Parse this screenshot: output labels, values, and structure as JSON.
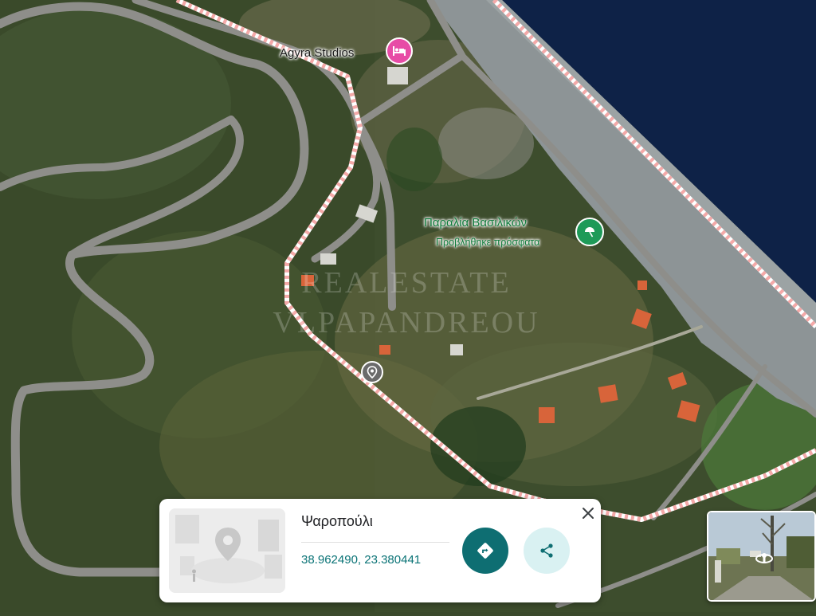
{
  "map": {
    "hotel": {
      "name": "Agyra Studios",
      "icon": "hotel-icon",
      "color": "#e74ca6"
    },
    "beach": {
      "name": "Παραλία Βασιλικών",
      "subtitle": "Προβλήθηκε πρόσφατα",
      "icon": "beach-icon",
      "color": "#1e9a58"
    },
    "dropped_pin": {
      "icon": "location-pin-icon"
    },
    "watermark": {
      "line1": "REALESTATE",
      "line2": "VLPAPANDREOU"
    },
    "boundary_color": "#f4a9a8",
    "sea_color": "#0e2247"
  },
  "place_card": {
    "name": "Ψαροπούλι",
    "coordinates": "38.962490, 23.380441",
    "thumbnail_icon": "location-placeholder-icon",
    "directions_icon": "directions-icon",
    "share_icon": "share-icon",
    "close_icon": "close-icon",
    "accent": "#0e6e72"
  },
  "street_view": {
    "icon": "rotate-360-icon"
  }
}
